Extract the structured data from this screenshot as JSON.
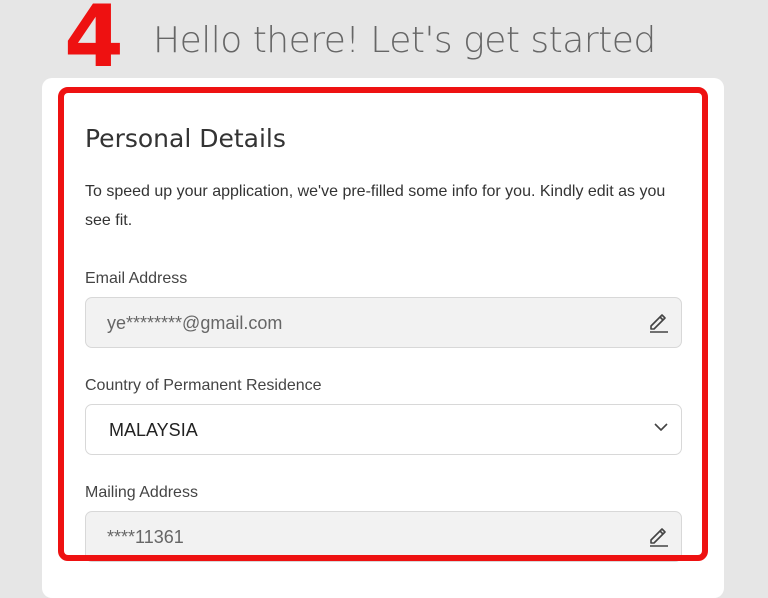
{
  "step": {
    "number": "4"
  },
  "header": {
    "title": "Hello there! Let's get started"
  },
  "section": {
    "title": "Personal Details",
    "intro": "To speed up your application, we've pre-filled some info for you. Kindly edit as you see fit."
  },
  "fields": {
    "email": {
      "label": "Email Address",
      "value": "ye********@gmail.com",
      "icon": "pencil-edit-icon"
    },
    "country": {
      "label": "Country of Permanent Residence",
      "value": "MALAYSIA",
      "icon": "chevron-down-icon"
    },
    "mailing": {
      "label": "Mailing Address",
      "value": "****11361",
      "icon": "pencil-edit-icon"
    }
  },
  "colors": {
    "highlight": "#ee1111",
    "background": "#e6e6e6",
    "card": "#ffffff",
    "field_readonly": "#f2f2f2"
  }
}
